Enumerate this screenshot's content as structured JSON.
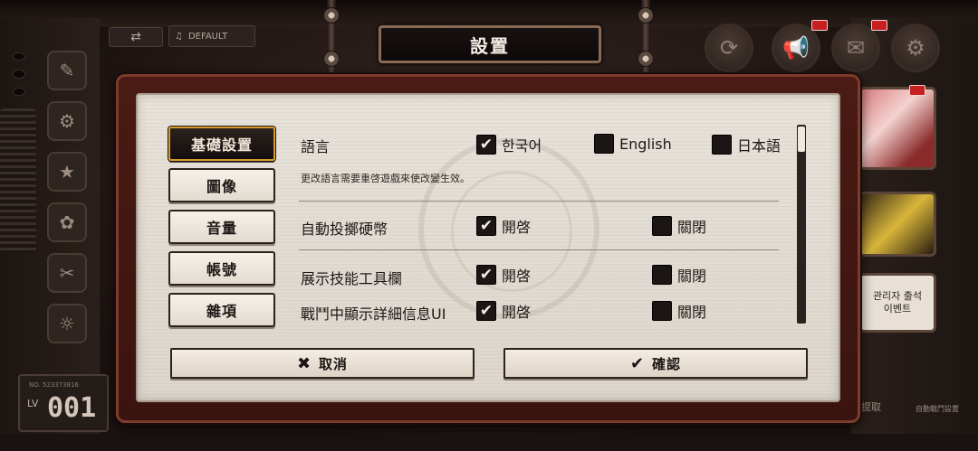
{
  "title": "設置",
  "hud": {
    "music_label": "DEFAULT",
    "player_id": "NO. 523373816",
    "level_label": "LV",
    "level_value": "001",
    "right_card_text": "관리자 출석\n이벤트",
    "bottom_btn1": "提取",
    "bottom_btn2": "自動戰鬥設置"
  },
  "categories": [
    {
      "label": "基礎設置",
      "active": true
    },
    {
      "label": "圖像",
      "active": false
    },
    {
      "label": "音量",
      "active": false
    },
    {
      "label": "帳號",
      "active": false
    },
    {
      "label": "雜項",
      "active": false
    }
  ],
  "settings": {
    "language": {
      "label": "語言",
      "options": [
        {
          "label": "한국어",
          "checked": true
        },
        {
          "label": "English",
          "checked": false
        },
        {
          "label": "日本語",
          "checked": false
        }
      ],
      "note": "更改語言需要重啓遊戲來使改變生效。"
    },
    "auto_coin": {
      "label": "自動投擲硬幣",
      "on_label": "開啓",
      "off_label": "關閉",
      "on_checked": true,
      "off_checked": false
    },
    "skill_bar": {
      "label": "展示技能工具欄",
      "on_label": "開啓",
      "off_label": "關閉",
      "on_checked": true,
      "off_checked": false
    },
    "battle_detail": {
      "label": "戰鬥中顯示詳細信息UI",
      "on_label": "開啓",
      "off_label": "關閉",
      "on_checked": true,
      "off_checked": false
    }
  },
  "footer": {
    "cancel_label": "取消",
    "confirm_label": "確認",
    "cancel_icon": "x-icon",
    "confirm_icon": "check-icon"
  },
  "colors": {
    "dialog_frame": "#4b1a14",
    "active_border": "#d89c2e",
    "paper": "#e7e2da"
  }
}
